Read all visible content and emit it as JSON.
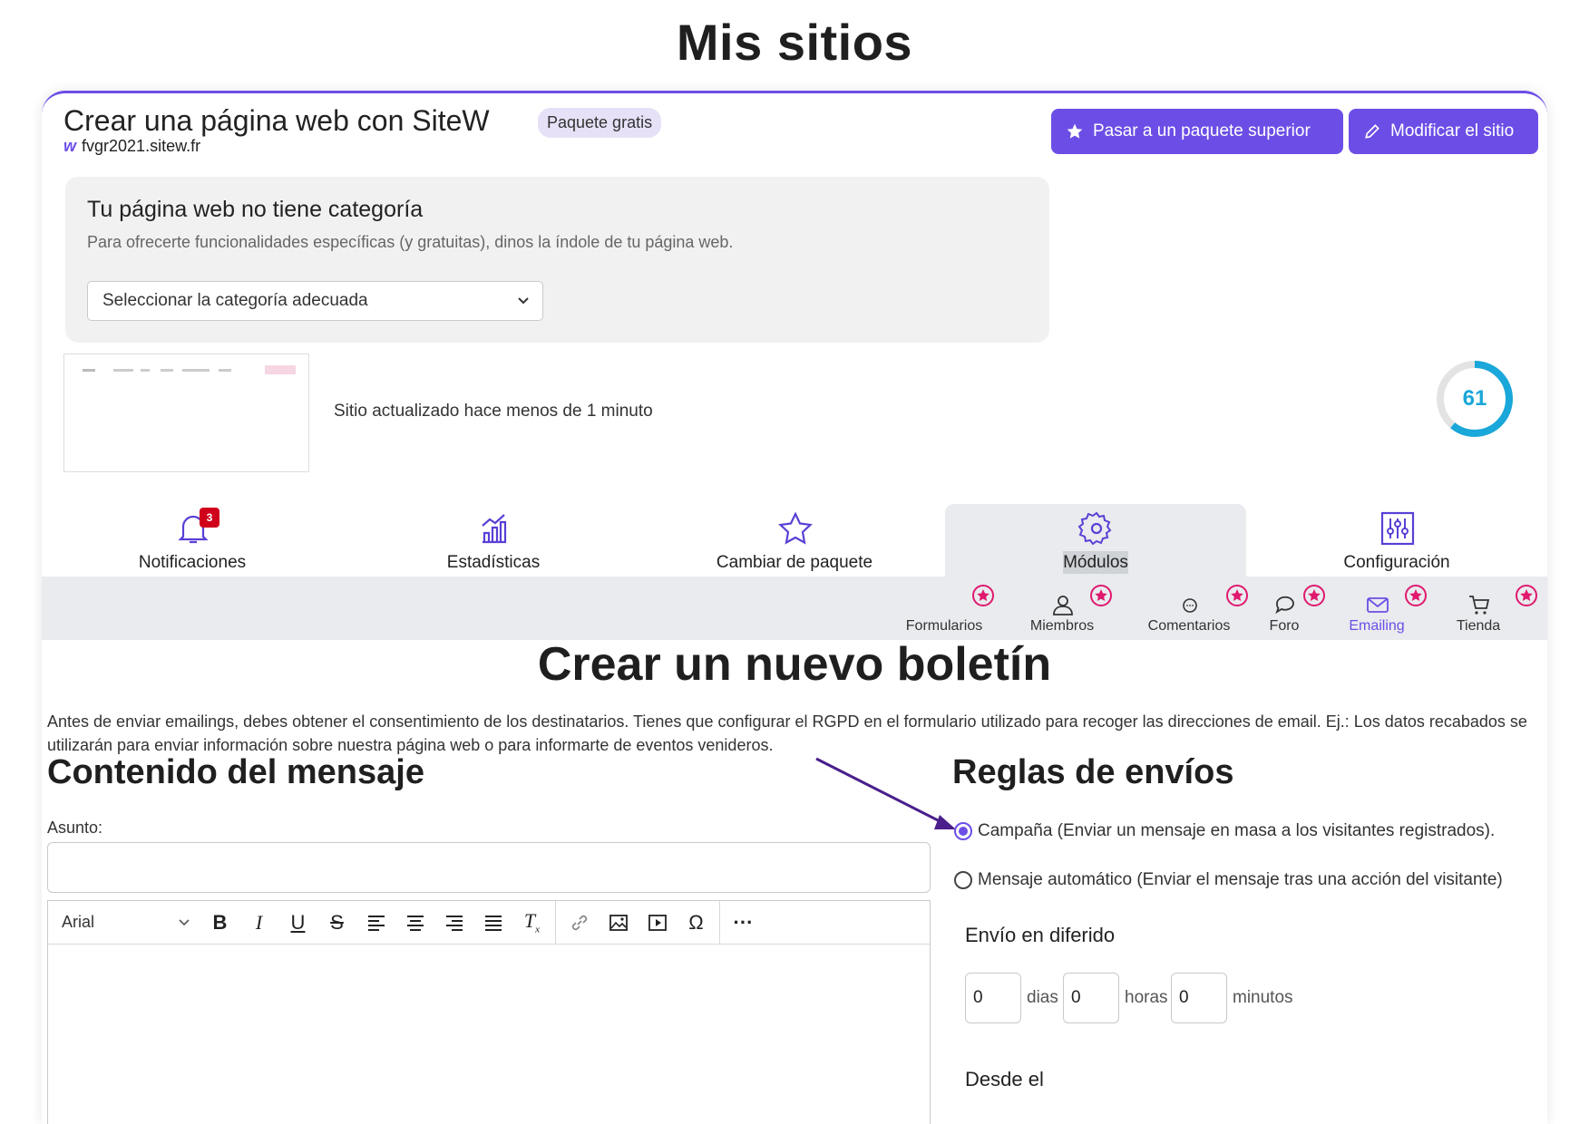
{
  "page": {
    "title": "Mis sitios"
  },
  "site": {
    "title": "Crear una página web con SiteW",
    "plan_badge": "Paquete gratis",
    "url": "fvgr2021.sitew.fr",
    "logo_letter": "w"
  },
  "actions": {
    "upgrade_label": "Pasar a un paquete superior",
    "edit_label": "Modificar el sitio"
  },
  "category": {
    "title": "Tu página web no tiene categoría",
    "subtitle": "Para ofrecerte funcionalidades específicas (y gratuitas), dinos la índole de tu página web.",
    "select_value": "Seleccionar la categoría adecuada"
  },
  "status": {
    "updated_text": "Sitio actualizado hace menos de 1 minuto",
    "score": "61",
    "score_fraction": 0.61,
    "score_color": "#1aa7d9"
  },
  "tabs": [
    {
      "label": "Notificaciones",
      "icon": "bell-icon",
      "badge": "3"
    },
    {
      "label": "Estadísticas",
      "icon": "chart-icon"
    },
    {
      "label": "Cambiar de paquete",
      "icon": "star-icon"
    },
    {
      "label": "Módulos",
      "icon": "gear-icon",
      "active": true
    },
    {
      "label": "Configuración",
      "icon": "sliders-icon"
    }
  ],
  "modules": [
    {
      "label": "Formularios",
      "icon": "form-icon",
      "premium": true
    },
    {
      "label": "Miembros",
      "icon": "user-icon",
      "premium": true
    },
    {
      "label": "Comentarios",
      "icon": "comment-icon",
      "premium": true
    },
    {
      "label": "Foro",
      "icon": "chat-icon",
      "premium": true
    },
    {
      "label": "Emailing",
      "icon": "mail-icon",
      "premium": true,
      "active": true
    },
    {
      "label": "Tienda",
      "icon": "cart-icon",
      "premium": true
    }
  ],
  "newsletter": {
    "title": "Crear un nuevo boletín",
    "notice": "Antes de enviar emailings, debes obtener el consentimiento de los destinatarios. Tienes que configurar el RGPD en el formulario utilizado para recoger las direcciones de email. Ej.: Los datos recabados se utilizarán para enviar información sobre nuestra página web o para informarte de eventos venideros.",
    "content_heading": "Contenido del mensaje",
    "subject_label": "Asunto:",
    "subject_value": "",
    "font_value": "Arial",
    "rules_heading": "Reglas de envíos",
    "option_campaign": "Campaña (Enviar un mensaje en masa a los visitantes registrados).",
    "option_auto": "Mensaje automático (Enviar el mensaje tras una acción del visitante)",
    "delay_title": "Envío en diferido",
    "days_value": "0",
    "days_unit": "dias",
    "hours_value": "0",
    "hours_unit": "horas",
    "minutes_value": "0",
    "minutes_unit": "minutos",
    "from_label": "Desde el"
  },
  "colors": {
    "accent": "#6c4ee6",
    "badge_red": "#d0021b",
    "premium_pink": "#e0196e"
  }
}
